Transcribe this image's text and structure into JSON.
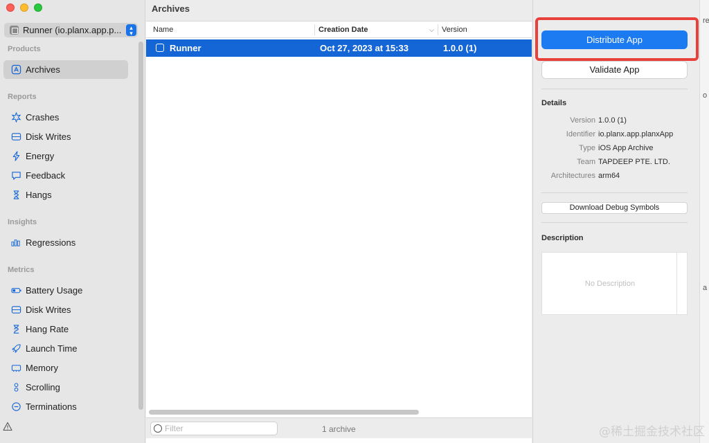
{
  "window": {
    "scheme_label": "Runner (io.planx.app.p..."
  },
  "sidebar": {
    "sections": [
      {
        "title": "Products",
        "items": [
          {
            "label": "Archives",
            "icon": "app-icon",
            "selected": true
          }
        ]
      },
      {
        "title": "Reports",
        "items": [
          {
            "label": "Crashes",
            "icon": "crash-icon"
          },
          {
            "label": "Disk Writes",
            "icon": "disk-icon"
          },
          {
            "label": "Energy",
            "icon": "bolt-icon"
          },
          {
            "label": "Feedback",
            "icon": "speech-bubble-icon"
          },
          {
            "label": "Hangs",
            "icon": "hourglass-icon"
          }
        ]
      },
      {
        "title": "Insights",
        "items": [
          {
            "label": "Regressions",
            "icon": "bar-chart-icon"
          }
        ]
      },
      {
        "title": "Metrics",
        "items": [
          {
            "label": "Battery Usage",
            "icon": "battery-icon"
          },
          {
            "label": "Disk Writes",
            "icon": "disk-icon"
          },
          {
            "label": "Hang Rate",
            "icon": "hourglass-icon"
          },
          {
            "label": "Launch Time",
            "icon": "rocket-icon"
          },
          {
            "label": "Memory",
            "icon": "memory-icon"
          },
          {
            "label": "Scrolling",
            "icon": "scroll-icon"
          },
          {
            "label": "Terminations",
            "icon": "minus-circle-icon"
          }
        ]
      }
    ]
  },
  "main": {
    "title": "Archives",
    "columns": [
      "Name",
      "Creation Date",
      "Version"
    ],
    "rows": [
      {
        "name": "Runner",
        "date": "Oct 27, 2023 at 15:33",
        "version": "1.0.0 (1)"
      }
    ],
    "filter_placeholder": "Filter",
    "archive_count": "1 archive"
  },
  "inspector": {
    "distribute_label": "Distribute App",
    "validate_label": "Validate App",
    "details_title": "Details",
    "details": [
      {
        "key": "Version",
        "value": "1.0.0 (1)"
      },
      {
        "key": "Identifier",
        "value": "io.planx.app.planxApp"
      },
      {
        "key": "Type",
        "value": "iOS App Archive"
      },
      {
        "key": "Team",
        "value": "TAPDEEP PTE. LTD."
      },
      {
        "key": "Architectures",
        "value": "arm64"
      }
    ],
    "download_symbols_label": "Download Debug Symbols",
    "description_title": "Description",
    "description_placeholder": "No Description"
  },
  "sliver": {
    "chars": [
      "re",
      "o",
      "a"
    ]
  },
  "watermark": "@稀土掘金技术社区",
  "colors": {
    "accent": "#1c7bf1",
    "selection": "#1466d6",
    "highlight": "#e8413b"
  }
}
